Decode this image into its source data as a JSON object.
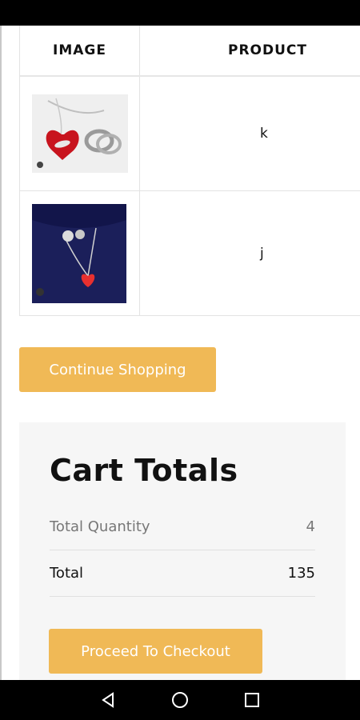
{
  "table": {
    "headers": {
      "image": "IMAGE",
      "product": "PRODUCT"
    },
    "rows": [
      {
        "product": "k",
        "image_icon": "heart-necklace-ring-image"
      },
      {
        "product": "j",
        "image_icon": "heart-necklace-blue-box-image"
      }
    ]
  },
  "buttons": {
    "continue_shopping": "Continue Shopping",
    "proceed_checkout": "Proceed To Checkout"
  },
  "totals": {
    "title": "Cart Totals",
    "quantity_label": "Total Quantity",
    "quantity_value": "4",
    "total_label": "Total",
    "total_value": "135"
  },
  "colors": {
    "accent": "#f0b956",
    "panel_bg": "#f6f6f6"
  },
  "nav": {
    "icons": [
      "back-icon",
      "home-icon",
      "recents-icon"
    ]
  }
}
